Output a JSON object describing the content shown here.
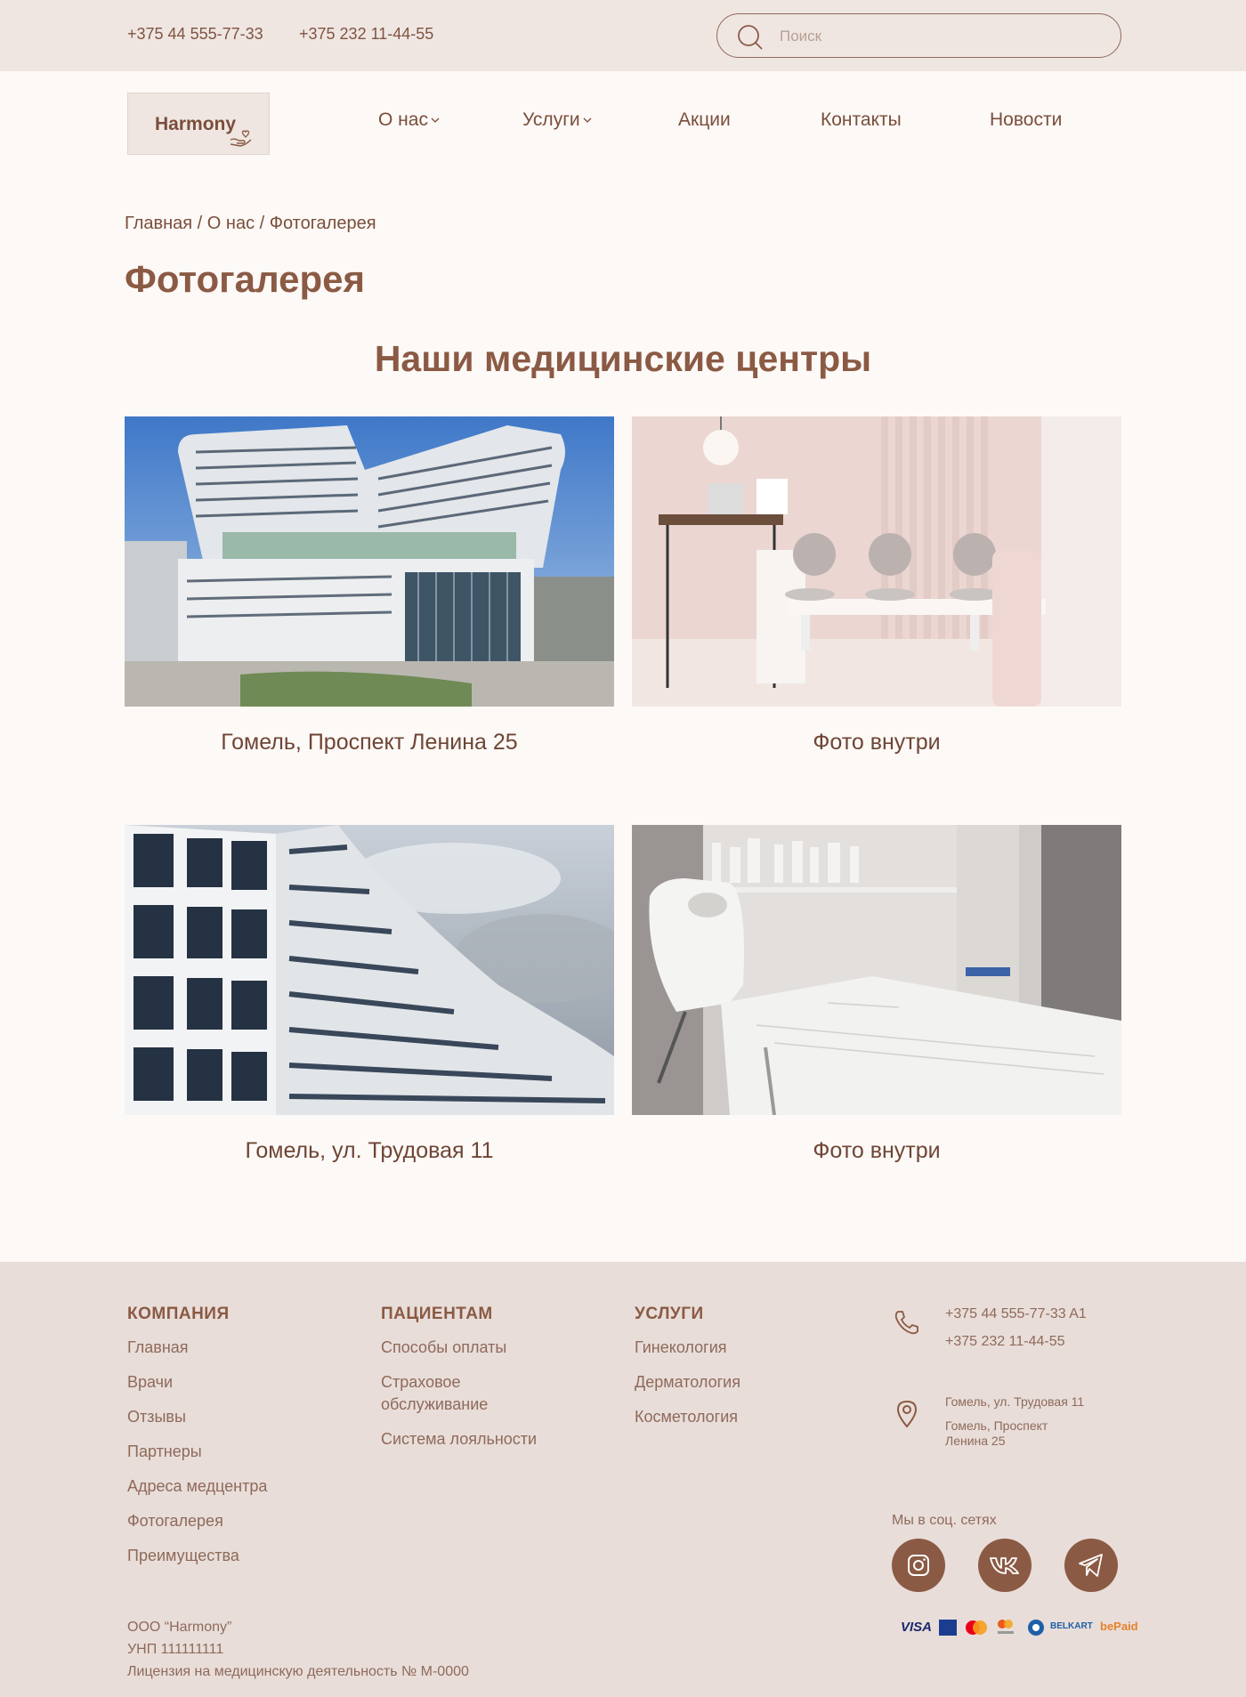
{
  "topbar": {
    "phone1": "+375 44 555-77-33",
    "phone2": "+375 232 11-44-55",
    "search_placeholder": "Поиск"
  },
  "header": {
    "logo_text": "Harmony",
    "nav": [
      {
        "label": "О нас",
        "has_dropdown": true
      },
      {
        "label": "Услуги",
        "has_dropdown": true
      },
      {
        "label": "Акции",
        "has_dropdown": false
      },
      {
        "label": "Контакты",
        "has_dropdown": false
      },
      {
        "label": "Новости",
        "has_dropdown": false
      }
    ]
  },
  "breadcrumb": "Главная / О нас / Фотогалерея",
  "page_title": "Фотогалерея",
  "section_title": "Наши медицинские центры",
  "gallery": [
    {
      "caption": "Гомель, Проспект Ленина 25",
      "icon": "building-photo"
    },
    {
      "caption": "Фото внутри",
      "icon": "interior-photo"
    },
    {
      "caption": "Гомель, ул. Трудовая 11",
      "icon": "building-photo"
    },
    {
      "caption": "Фото внутри",
      "icon": "treatment-room-photo"
    }
  ],
  "footer": {
    "company": {
      "heading": "КОМПАНИЯ",
      "links": [
        "Главная",
        "Врачи",
        "Отзывы",
        "Партнеры",
        "Адреса медцентра",
        "Фотогалерея",
        "Преимущества"
      ]
    },
    "patients": {
      "heading": "ПАЦИЕНТАМ",
      "links": [
        "Способы оплаты",
        "Страховое обслуживание",
        "Система лояльности"
      ]
    },
    "services": {
      "heading": "УСЛУГИ",
      "links": [
        "Гинекология",
        "Дерматология",
        "Косметология"
      ]
    },
    "contacts": {
      "phone1": "+375 44 555-77-33 A1",
      "phone2": "+375 232 11-44-55",
      "address1": "Гомель, ул. Трудовая 11",
      "address2": "Гомель, Проспект Ленина 25"
    },
    "social_title": "Мы в соц. сетях",
    "social": [
      "instagram-icon",
      "vk-icon",
      "telegram-icon"
    ],
    "legal": {
      "company": "ООО “Harmony”",
      "unp": "УНП 111111111",
      "license": "Лицензия на медицинскую деятельность № М-0000"
    },
    "payments": [
      "VISA",
      "BELKART",
      "bePaid"
    ]
  },
  "colors": {
    "topbar_bg": "#efe6e2",
    "page_bg": "#fdf9f6",
    "footer_bg": "#e8ddd9",
    "accent": "#8b5a44",
    "text": "#7a4e3b"
  }
}
